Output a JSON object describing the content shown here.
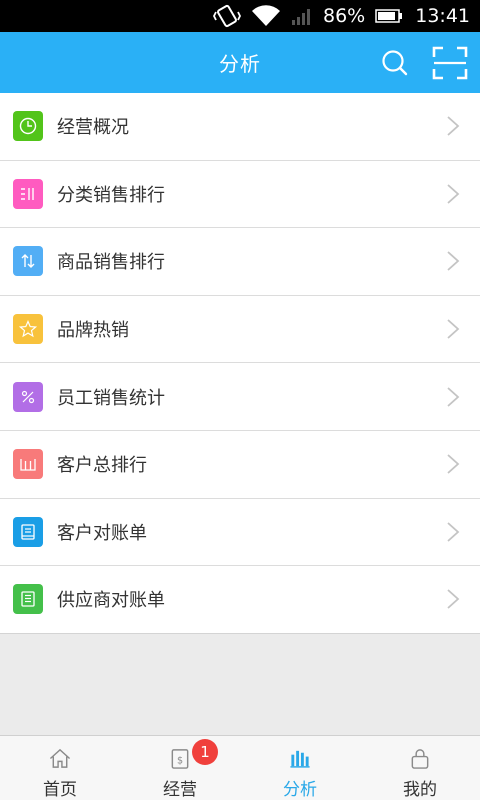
{
  "status_bar": {
    "battery_percent": "86%",
    "time": "13:41"
  },
  "header": {
    "title": "分析"
  },
  "menu": {
    "items": [
      {
        "label": "经营概况",
        "icon": "clock-icon",
        "color": "#52c41a"
      },
      {
        "label": "分类销售排行",
        "icon": "category-bars-icon",
        "color": "#ff5bc0"
      },
      {
        "label": "商品销售排行",
        "icon": "sort-arrows-icon",
        "color": "#52aef5"
      },
      {
        "label": "品牌热销",
        "icon": "star-icon",
        "color": "#f8c23c"
      },
      {
        "label": "员工销售统计",
        "icon": "percent-icon",
        "color": "#b26ee6"
      },
      {
        "label": "客户总排行",
        "icon": "ranking-bars-icon",
        "color": "#f87a7a"
      },
      {
        "label": "客户对账单",
        "icon": "receipt-icon",
        "color": "#1a9ee6"
      },
      {
        "label": "供应商对账单",
        "icon": "ledger-icon",
        "color": "#44c04a"
      }
    ]
  },
  "tab_bar": {
    "tabs": [
      {
        "label": "首页",
        "icon": "home-icon"
      },
      {
        "label": "经营",
        "icon": "business-doc-icon",
        "badge": "1"
      },
      {
        "label": "分析",
        "icon": "bar-chart-icon",
        "active": true
      },
      {
        "label": "我的",
        "icon": "lock-icon"
      }
    ]
  },
  "colors": {
    "header_bg": "#2ab0f6",
    "accent": "#2aa8e8",
    "badge": "#f0403c"
  }
}
